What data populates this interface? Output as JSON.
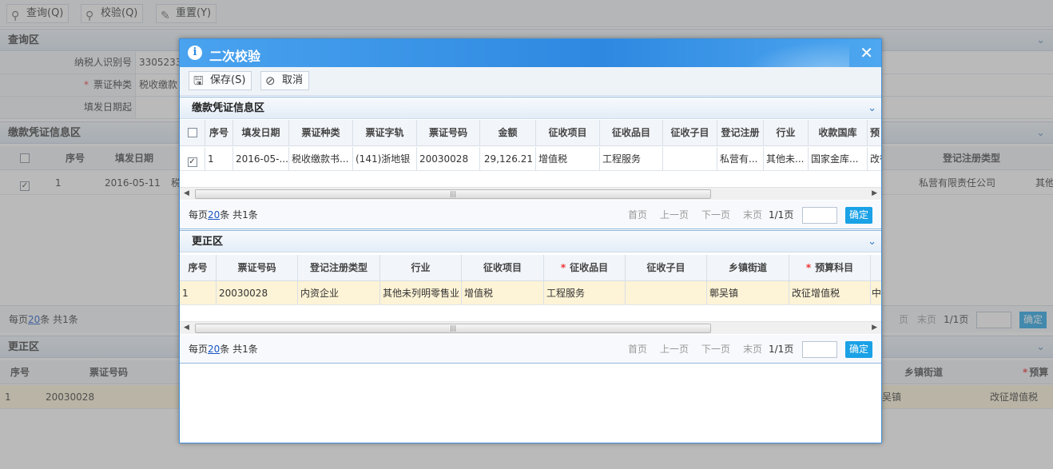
{
  "background": {
    "toolbar": [
      {
        "label": "查询(Q)"
      },
      {
        "label": "校验(Q)"
      },
      {
        "label": "重置(Y)"
      }
    ],
    "query_area": {
      "title": "查询区",
      "taxpayer_id_label": "纳税人识别号",
      "taxpayer_id_value": "3305233",
      "ticket_type_label": "票证种类",
      "ticket_type_value": "税收缴款",
      "issue_date_label": "填发日期起"
    },
    "payment_area": {
      "title": "缴款凭证信息区",
      "headers": [
        "序号",
        "填发日期",
        "登记注册类型",
        "其他"
      ],
      "row": {
        "index": "1",
        "date": "2016-05-11",
        "ticket_prefix": "税",
        "reg_type": "私营有限责任公司",
        "other": "其他"
      },
      "pager": {
        "per_page_prefix": "每页",
        "per_page": "20",
        "per_page_suffix": "条 共1条",
        "last": "末页",
        "current": "1/1页",
        "ok": "确定",
        "prev_fragment": "页"
      }
    },
    "correction_area": {
      "title": "更正区",
      "headers": [
        "序号",
        "票证号码",
        "乡镇街道",
        "预算"
      ],
      "row": {
        "index": "1",
        "ticket_no": "20030028",
        "town_fragment": "吴镇",
        "budget": "改征增值税"
      }
    }
  },
  "dialog": {
    "title": "二次校验",
    "close_glyph": "✕",
    "toolbar": {
      "save_label": "保存(S)",
      "cancel_label": "取消"
    },
    "payment_section": {
      "title": "缴款凭证信息区",
      "headers": [
        "序号",
        "填发日期",
        "票证种类",
        "票证字轨",
        "票证号码",
        "金额",
        "征收项目",
        "征收品目",
        "征收子目",
        "登记注册",
        "行业",
        "收款国库",
        "预"
      ],
      "row": {
        "checked": true,
        "index": "1",
        "issue_date": "2016-05-...",
        "ticket_type": "税收缴款书...",
        "ticket_track": "(141)浙地银",
        "ticket_no": "20030028",
        "amount": "29,126.21",
        "tax_item": "增值税",
        "tax_category": "工程服务",
        "tax_subitem": "",
        "reg_type": "私营有...",
        "industry": "其他未...",
        "treasury": "国家金库...",
        "budget": "改征"
      },
      "pager": {
        "per_page_prefix": "每页",
        "per_page": "20",
        "per_page_suffix": "条 共1条",
        "first": "首页",
        "prev": "上一页",
        "next": "下一页",
        "last": "末页",
        "current": "1/1页",
        "goto_value": "",
        "ok": "确定"
      }
    },
    "correction_section": {
      "title": "更正区",
      "headers": [
        "序号",
        "票证号码",
        "登记注册类型",
        "行业",
        "征收项目",
        "征收品目",
        "征收子目",
        "乡镇街道",
        "预算科目"
      ],
      "required_headers": [
        "征收品目",
        "预算科目"
      ],
      "row": {
        "index": "1",
        "ticket_no": "20030028",
        "reg_type": "内资企业",
        "industry": "其他未列明零售业",
        "tax_item": "增值税",
        "tax_category": "工程服务",
        "tax_subitem": "",
        "town": "鄣吴镇",
        "budget": "改征增值税",
        "extra": "中"
      },
      "pager": {
        "per_page_prefix": "每页",
        "per_page": "20",
        "per_page_suffix": "条 共1条",
        "first": "首页",
        "prev": "上一页",
        "next": "下一页",
        "last": "末页",
        "current": "1/1页",
        "goto_value": "",
        "ok": "确定"
      }
    }
  },
  "colors": {
    "title_bar": "#2e88e0",
    "ok_button": "#1aa1e6",
    "selected_row": "#fdf3d6",
    "required_star": "#ee3333"
  }
}
